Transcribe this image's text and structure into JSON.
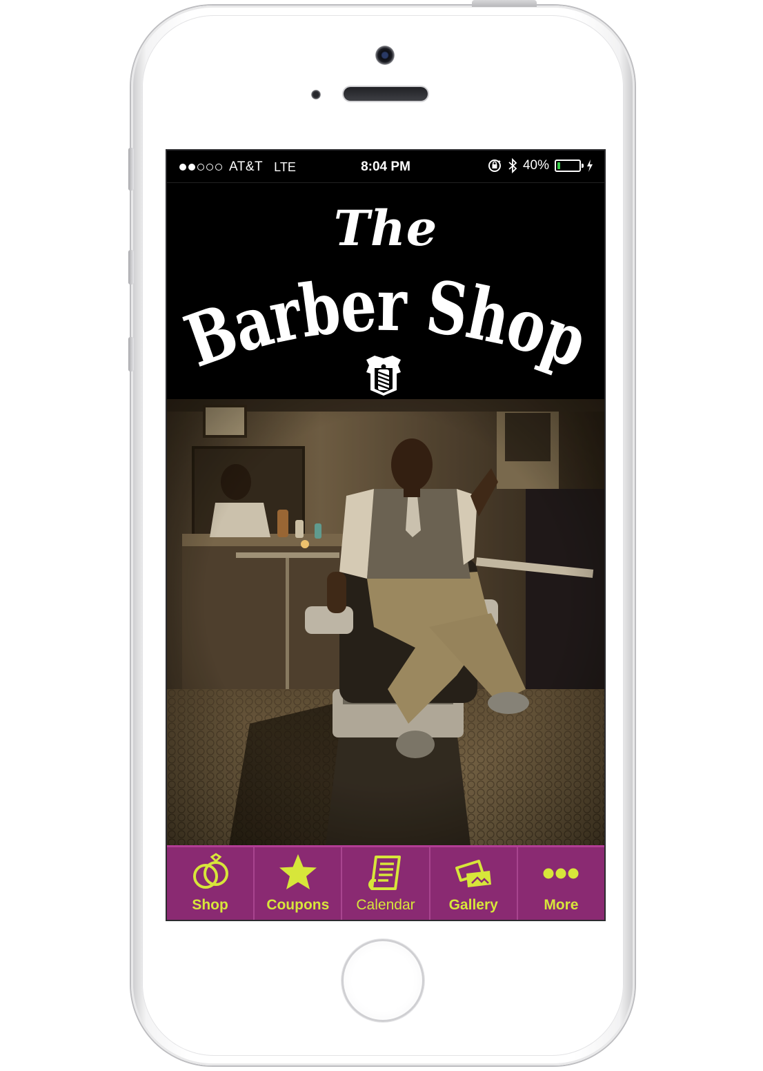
{
  "status_bar": {
    "carrier": "AT&T",
    "network": "LTE",
    "time": "8:04 PM",
    "battery_percent": "40%",
    "signal_bars_filled": 2,
    "signal_bars_total": 5
  },
  "logo": {
    "line1": "The",
    "line2": "Barber Shop"
  },
  "tabs": [
    {
      "label": "Shop",
      "icon": "rings-icon"
    },
    {
      "label": "Coupons",
      "icon": "star-icon"
    },
    {
      "label": "Calendar",
      "icon": "calendar-icon"
    },
    {
      "label": "Gallery",
      "icon": "photos-icon"
    },
    {
      "label": "More",
      "icon": "more-dots-icon"
    }
  ],
  "colors": {
    "tabbar_bg": "#8a2a72",
    "tab_accent": "#d7e63a",
    "battery_fill": "#39d14b"
  }
}
